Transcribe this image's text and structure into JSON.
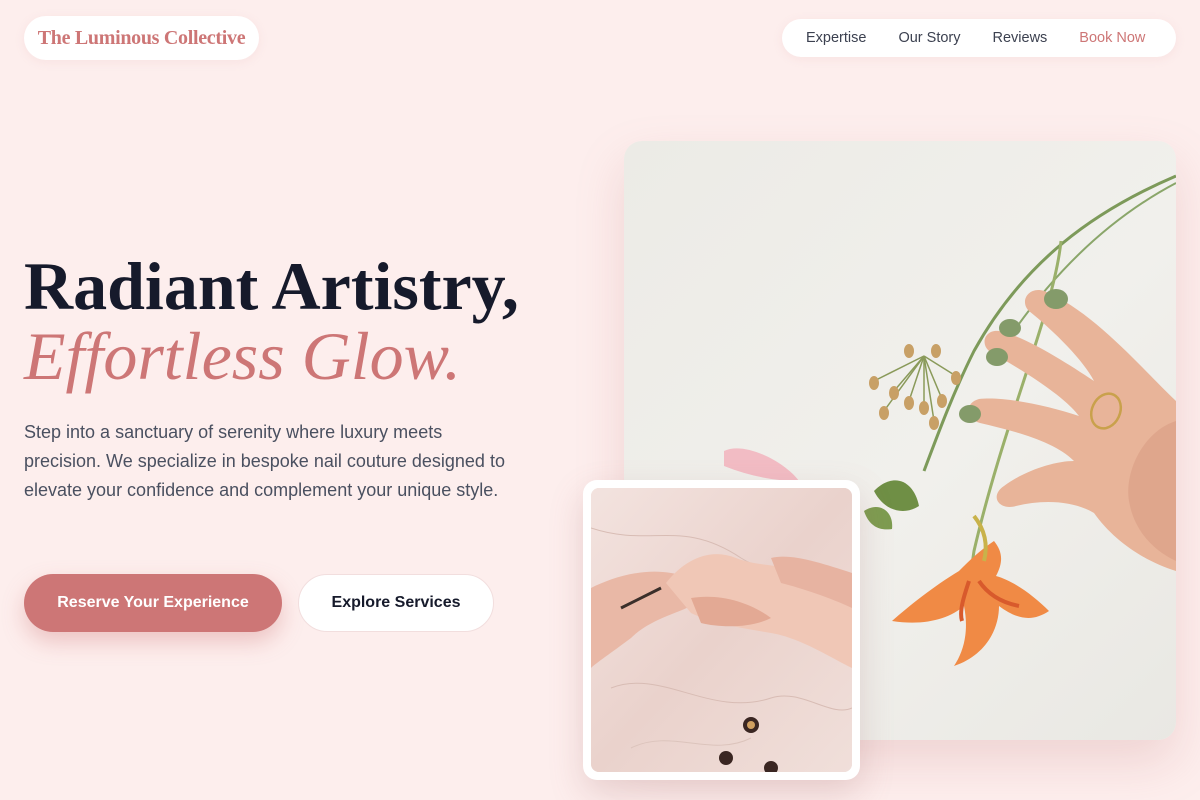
{
  "brand": {
    "name": "The Luminous Collective",
    "accent_color": "#cd7676",
    "background_color": "#fdeeed"
  },
  "nav": {
    "items": [
      {
        "label": "Expertise"
      },
      {
        "label": "Our Story"
      },
      {
        "label": "Reviews"
      },
      {
        "label": "Book Now"
      }
    ]
  },
  "hero": {
    "headline_line1": "Radiant Artistry,",
    "headline_line2": "Effortless Glow.",
    "intro": "Step into a sanctuary of serenity where luxury meets precision. We specialize in bespoke nail couture designed to elevate your confidence and complement your unique style.",
    "primary_cta": "Reserve Your Experience",
    "secondary_cta": "Explore Services"
  },
  "images": {
    "main": "photo of a hand with sage green manicure touching orange nasturtium flowers on a pale background",
    "inset": "photo of a manicurist painting a client's nails on a marble table"
  }
}
